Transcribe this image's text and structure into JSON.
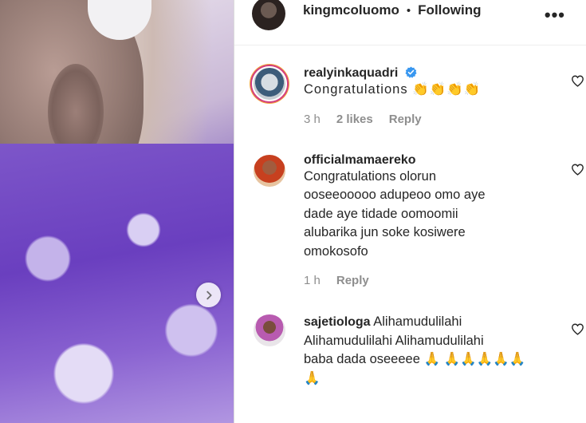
{
  "post": {
    "author": "kingmcoluomo",
    "separator": "•",
    "follow_status": "Following",
    "more_label": "•••"
  },
  "comments": [
    {
      "username": "realyinkaquadri",
      "verified": true,
      "text": "Congratulations 👏👏👏👏",
      "time": "3 h",
      "likes": "2 likes",
      "reply": "Reply"
    },
    {
      "username": "officialmamaereko",
      "text_lines": [
        "Congratulations olorun",
        "ooseeooooo adupeoo omo aye",
        "dade aye tidade oomoomii",
        "alubarika jun soke kosiwere",
        "omokosofo"
      ],
      "time": "1 h",
      "reply": "Reply"
    },
    {
      "username": "sajetiologa",
      "text_first": "Alihamudulilahi",
      "text_lines": [
        "Alihamudulilahi Alihamudulilahi",
        "baba dada oseeeee 🙏 🙏🙏🙏🙏🙏",
        "🙏"
      ]
    }
  ],
  "icons": {
    "next": "chevron-right-icon",
    "heart": "heart-outline-icon",
    "verified": "verified-badge-icon"
  },
  "colors": {
    "verified_blue": "#3897f0",
    "muted_text": "#8e8e8e"
  }
}
